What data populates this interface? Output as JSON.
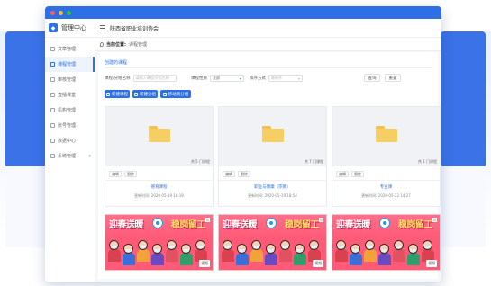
{
  "app": {
    "title": "管理中心",
    "org": "陕西省职业培训协会"
  },
  "breadcrumb": {
    "prefix": "当前位置:",
    "current": "课程管理"
  },
  "sidebar": {
    "items": [
      {
        "label": "文章管理",
        "icon": "article-icon"
      },
      {
        "label": "课程管理",
        "icon": "course-icon",
        "active": true
      },
      {
        "label": "审核管理",
        "icon": "audit-icon"
      },
      {
        "label": "直播课堂",
        "icon": "live-icon"
      },
      {
        "label": "机构管理",
        "icon": "org-icon"
      },
      {
        "label": "账号管理",
        "icon": "account-icon"
      },
      {
        "label": "数据中心",
        "icon": "data-icon"
      },
      {
        "label": "系统管理",
        "icon": "settings-icon",
        "has_children": true
      }
    ]
  },
  "panel": {
    "title": "创建的课程"
  },
  "filters": {
    "name_label": "课程/分组名称",
    "name_placeholder": "请输入课程/分组名称",
    "type_label": "课程性质",
    "type_value": "全部",
    "sort_label": "排序方式",
    "sort_value": "最新序",
    "search_label": "查询",
    "reset_label": "重置"
  },
  "actions": {
    "new_course": "新建课程",
    "new_group": "新建分组",
    "move_group": "移动到分组"
  },
  "cards": [
    {
      "name": "德育课程",
      "count": "共 5 门课程",
      "time": "更新时间: 2020-05-19 18:18",
      "edit": "编辑",
      "delete": "删除"
    },
    {
      "name": "职业与健康（宗教）",
      "count": "共 7 门课程",
      "time": "更新时间: 2020-05-19 18:54",
      "edit": "编辑",
      "delete": "删除"
    },
    {
      "name": "专业课",
      "count": "共 1 门课程",
      "time": "更新时间: 2020-05-22 14:27",
      "edit": "编辑",
      "delete": "删除"
    }
  ],
  "promos": [
    {
      "left": "迎春送暖",
      "right": "稳岗留工",
      "tag": "视频"
    },
    {
      "left": "迎春送暖",
      "right": "稳岗留工",
      "tag": "视频"
    },
    {
      "left": "迎春送暖",
      "right": "稳岗留工",
      "tag": "视频"
    }
  ],
  "colors": {
    "accent": "#2e6fe6",
    "folder": "#f5cf63",
    "promo": "#ff5a77"
  }
}
